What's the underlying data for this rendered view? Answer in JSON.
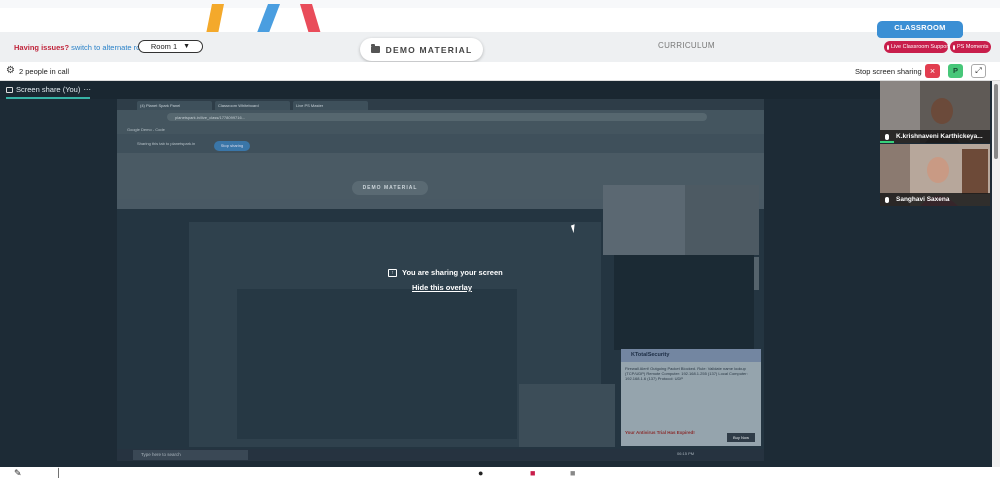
{
  "header": {
    "issues_text": "Having issues?",
    "alternate_link": "switch to alternate room",
    "room_value": "Room 1",
    "demo_material_label": "DEMO MATERIAL",
    "curriculum_label": "CURRICULUM",
    "classroom_tab": "CLASSROOM",
    "live_support_label": "Live Classroom Support",
    "ps_moments_label": "PS Moments"
  },
  "callbar": {
    "people_count": "2 people in call",
    "stop_sharing_label": "Stop screen sharing",
    "stop_icon": "×",
    "avatar_letter": "P",
    "expand_icon": "⤢"
  },
  "share": {
    "tab_label": "Screen share (You)",
    "tab_menu": "⋯",
    "overlay_message": "You are sharing your screen",
    "hide_overlay_link": "Hide this overlay"
  },
  "preview": {
    "tab1": "(4) Planet Spark Panel",
    "tab2": "Classroom Whiteboard",
    "tab3": "Live PS Master",
    "url": "planetspark.in/live_class/1778099716...",
    "bookmarks": "Google   Demo - Code",
    "sharing_text": "Sharing this tab to planetspark.in",
    "stop_sharing": "Stop sharing",
    "demo_material": "DEMO MATERIAL",
    "kt_title": "KTotalSecurity",
    "kt_body": "Firewall Alert! Outgoing Packet Blocked. Rule: Validate name lookup (TCP/UDP) Remote Computer: 192.168.1.255 (137) Local Computer: 192.168.1.6 (137) Protocol: UDP",
    "kt_alert": "Your Antivirus Trial Has Expired!",
    "kt_buy": "Buy Now",
    "taskbar_search": "Type here to search",
    "tray_time": "06:15 PM"
  },
  "participants": [
    {
      "name": "K.krishnaveni Karthickeya..."
    },
    {
      "name": "Sanghavi Saxena"
    }
  ],
  "colors": {
    "accent_blue": "#3b8fd4",
    "support_pill": "#c81e4b",
    "stop_red": "#e23d4f",
    "avatar_green": "#47c779",
    "stage_dark": "#1d2b36",
    "share_underline": "#37b3a6"
  }
}
